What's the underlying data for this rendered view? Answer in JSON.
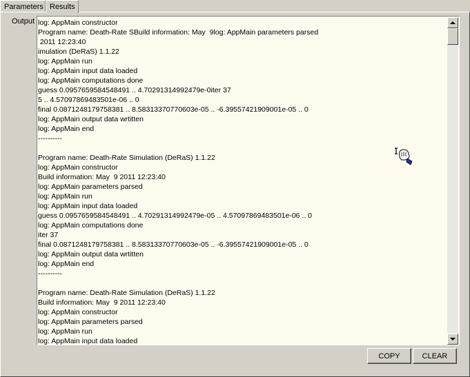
{
  "tabs": [
    {
      "label": "Parameters"
    },
    {
      "label": "Results"
    }
  ],
  "output": {
    "label": "Output",
    "lines": [
      "log: AppMain constructor",
      "Program name: Death-Rate SBuild information: May  9log: AppMain parameters parsed",
      " 2011 12:23:40",
      "imulation (DeRaS) 1.1.22",
      "log: AppMain run",
      "log: AppMain input data loaded",
      "log: AppMain computations done",
      "guess 0.0957659584548491 .. 4.70291314992479e-0iter 37",
      "5 .. 4.57097869483501e-06 .. 0",
      "final 0.0871248179758381 .. 8.58313370770603e-05 .. -6.39557421909001e-05 .. 0",
      "log: AppMain output data wrtitten",
      "log: AppMain end",
      "----------",
      "",
      "Program name: Death-Rate Simulation (DeRaS) 1.1.22",
      "log: AppMain constructor",
      "Build information: May  9 2011 12:23:40",
      "log: AppMain parameters parsed",
      "log: AppMain run",
      "log: AppMain input data loaded",
      "guess 0.0957659584548491 .. 4.70291314992479e-05 .. 4.57097869483501e-06 .. 0",
      "log: AppMain computations done",
      "iter 37",
      "final 0.0871248179758381 .. 8.58313370770603e-05 .. -6.39557421909001e-05 .. 0",
      "log: AppMain output data wrtitten",
      "log: AppMain end",
      "----------",
      "",
      "Program name: Death-Rate Simulation (DeRaS) 1.1.22",
      "Build information: May  9 2011 12:23:40",
      "log: AppMain constructor",
      "log: AppMain parameters parsed",
      "log: AppMain run",
      "log: AppMain input data loaded"
    ]
  },
  "buttons": {
    "copy": "COPY",
    "clear": "CLEAR"
  },
  "icons": {
    "cursor": "hand-pointer-cursor-icon"
  }
}
